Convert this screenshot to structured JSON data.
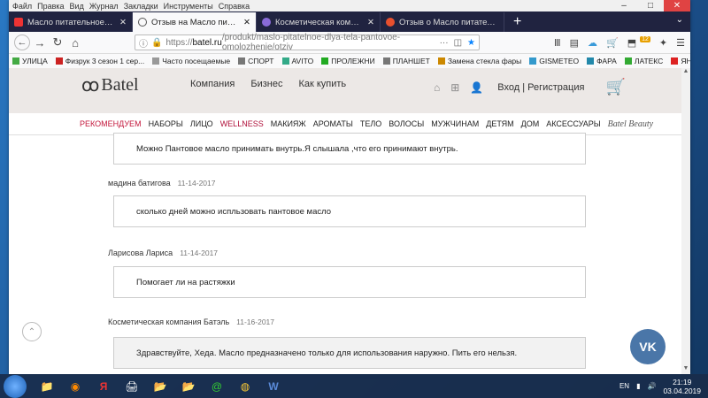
{
  "menubar": [
    "Файл",
    "Правка",
    "Вид",
    "Журнал",
    "Закладки",
    "Инструменты",
    "Справка"
  ],
  "tabs": [
    {
      "title": "Масло питательное для тела с",
      "active": false,
      "fav": "#e33"
    },
    {
      "title": "Отзыв на Масло питательное",
      "active": true,
      "fav": "#555"
    },
    {
      "title": "Косметическая компания - Бате",
      "active": false,
      "fav": "#8a6bd8"
    },
    {
      "title": "Отзыв о Масло питательное д",
      "active": false,
      "fav": "#e8502e"
    }
  ],
  "url": {
    "proto": "https://",
    "host": "batel.ru",
    "path": "/produkt/maslo-pitatelnoe-dlya-tela-pantovoe-omolozhenie/otziv"
  },
  "toolbar_badge": "12",
  "bookmarks": [
    {
      "label": "УЛИЦА",
      "color": "#4a4"
    },
    {
      "label": "Физрук 3 сезон 1 сер...",
      "color": "#c22"
    },
    {
      "label": "Часто посещаемые",
      "color": "#999"
    },
    {
      "label": "СПОРТ",
      "color": "#777"
    },
    {
      "label": "AVITO",
      "color": "#3a8"
    },
    {
      "label": "ПРОЛЕЖНИ",
      "color": "#2a2"
    },
    {
      "label": "ПЛАНШЕТ",
      "color": "#777"
    },
    {
      "label": "Замена стекла фары",
      "color": "#c80"
    },
    {
      "label": "GISMETEO",
      "color": "#39c"
    },
    {
      "label": "ФАРА",
      "color": "#28a"
    },
    {
      "label": "ЛАТЕКС",
      "color": "#3a3"
    },
    {
      "label": "ЯНДЕКС",
      "color": "#d22"
    }
  ],
  "site": {
    "logo": "Batel",
    "nav": [
      "Компания",
      "Бизнес",
      "Как купить"
    ],
    "login": "Вход | Регистрация",
    "categories": [
      "РЕКОМЕНДУЕМ",
      "НАБОРЫ",
      "ЛИЦО",
      "WELLNESS",
      "МАКИЯЖ",
      "АРОМАТЫ",
      "ТЕЛО",
      "ВОЛОСЫ",
      "МУЖЧИНАМ",
      "ДЕТЯМ",
      "ДОМ",
      "АКСЕССУАРЫ"
    ],
    "beauty": "Batel Beauty"
  },
  "reviews": [
    {
      "name": "",
      "date": "",
      "text": "Можно Пантовое масло принимать внутрь.Я слышала ,что его принимают внутрь.",
      "grey": false
    },
    {
      "name": "мадина батигова",
      "date": "11-14-2017",
      "text": "сколько дней можно испльзовать пантовое масло",
      "grey": false
    },
    {
      "name": "Ларисова Лариса",
      "date": "11-14-2017",
      "text": "Помогает ли на растяжки",
      "grey": false
    },
    {
      "name": "Косметическая компания Батэль",
      "date": "11-16-2017",
      "text": "Здравствуйте, Хеда. Масло предназначено только для использования наружно. Пить его нельзя.",
      "grey": true
    }
  ],
  "vk": "VK",
  "tray": {
    "lang": "EN",
    "time": "21:19",
    "date": "03.04.2019"
  }
}
